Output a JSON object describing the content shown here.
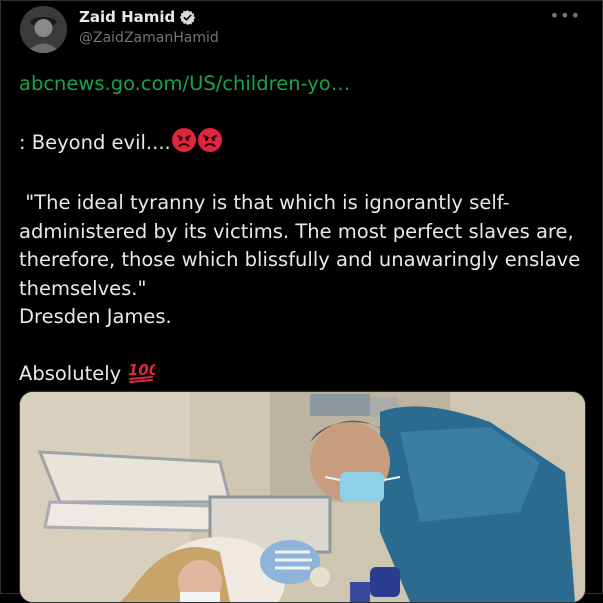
{
  "author": {
    "name": "Zaid Hamid",
    "handle": "@ZaidZamanHamid",
    "verified": true
  },
  "tweet": {
    "link_text": "abcnews.go.com/US/children-yo…",
    "line1": ": Beyond evil....",
    "quote": " \"The ideal tyranny is that which is ignorantly self-administered by its victims. The most perfect slaves are, therefore, those which blissfully and unawaringly enslave themselves.\"",
    "attribution": "Dresden James.",
    "closing": "Absolutely"
  },
  "icons": {
    "more": "more-icon",
    "verified": "verified-badge-icon",
    "angry": "angry-face-emoji",
    "hundred": "hundred-points-emoji"
  },
  "colors": {
    "background": "#000000",
    "text": "#e7e9ea",
    "secondary": "#71767b",
    "link": "#1aa34a",
    "verified": "#d9d9d9",
    "angry": "#e0253e",
    "hundred": "#e0253e"
  }
}
